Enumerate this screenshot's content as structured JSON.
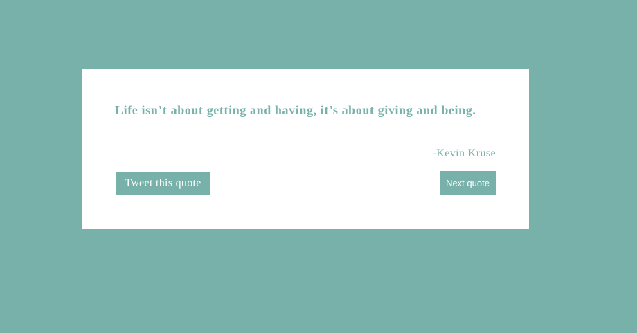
{
  "quote": {
    "text": "Life isn’t about getting and having, it’s about giving and being.",
    "author": "-Kevin Kruse"
  },
  "actions": {
    "tweet_label": "Tweet this quote",
    "next_label": "Next quote"
  },
  "colors": {
    "background": "#77b1a9",
    "card": "#ffffff",
    "accent": "#77b1a9"
  }
}
